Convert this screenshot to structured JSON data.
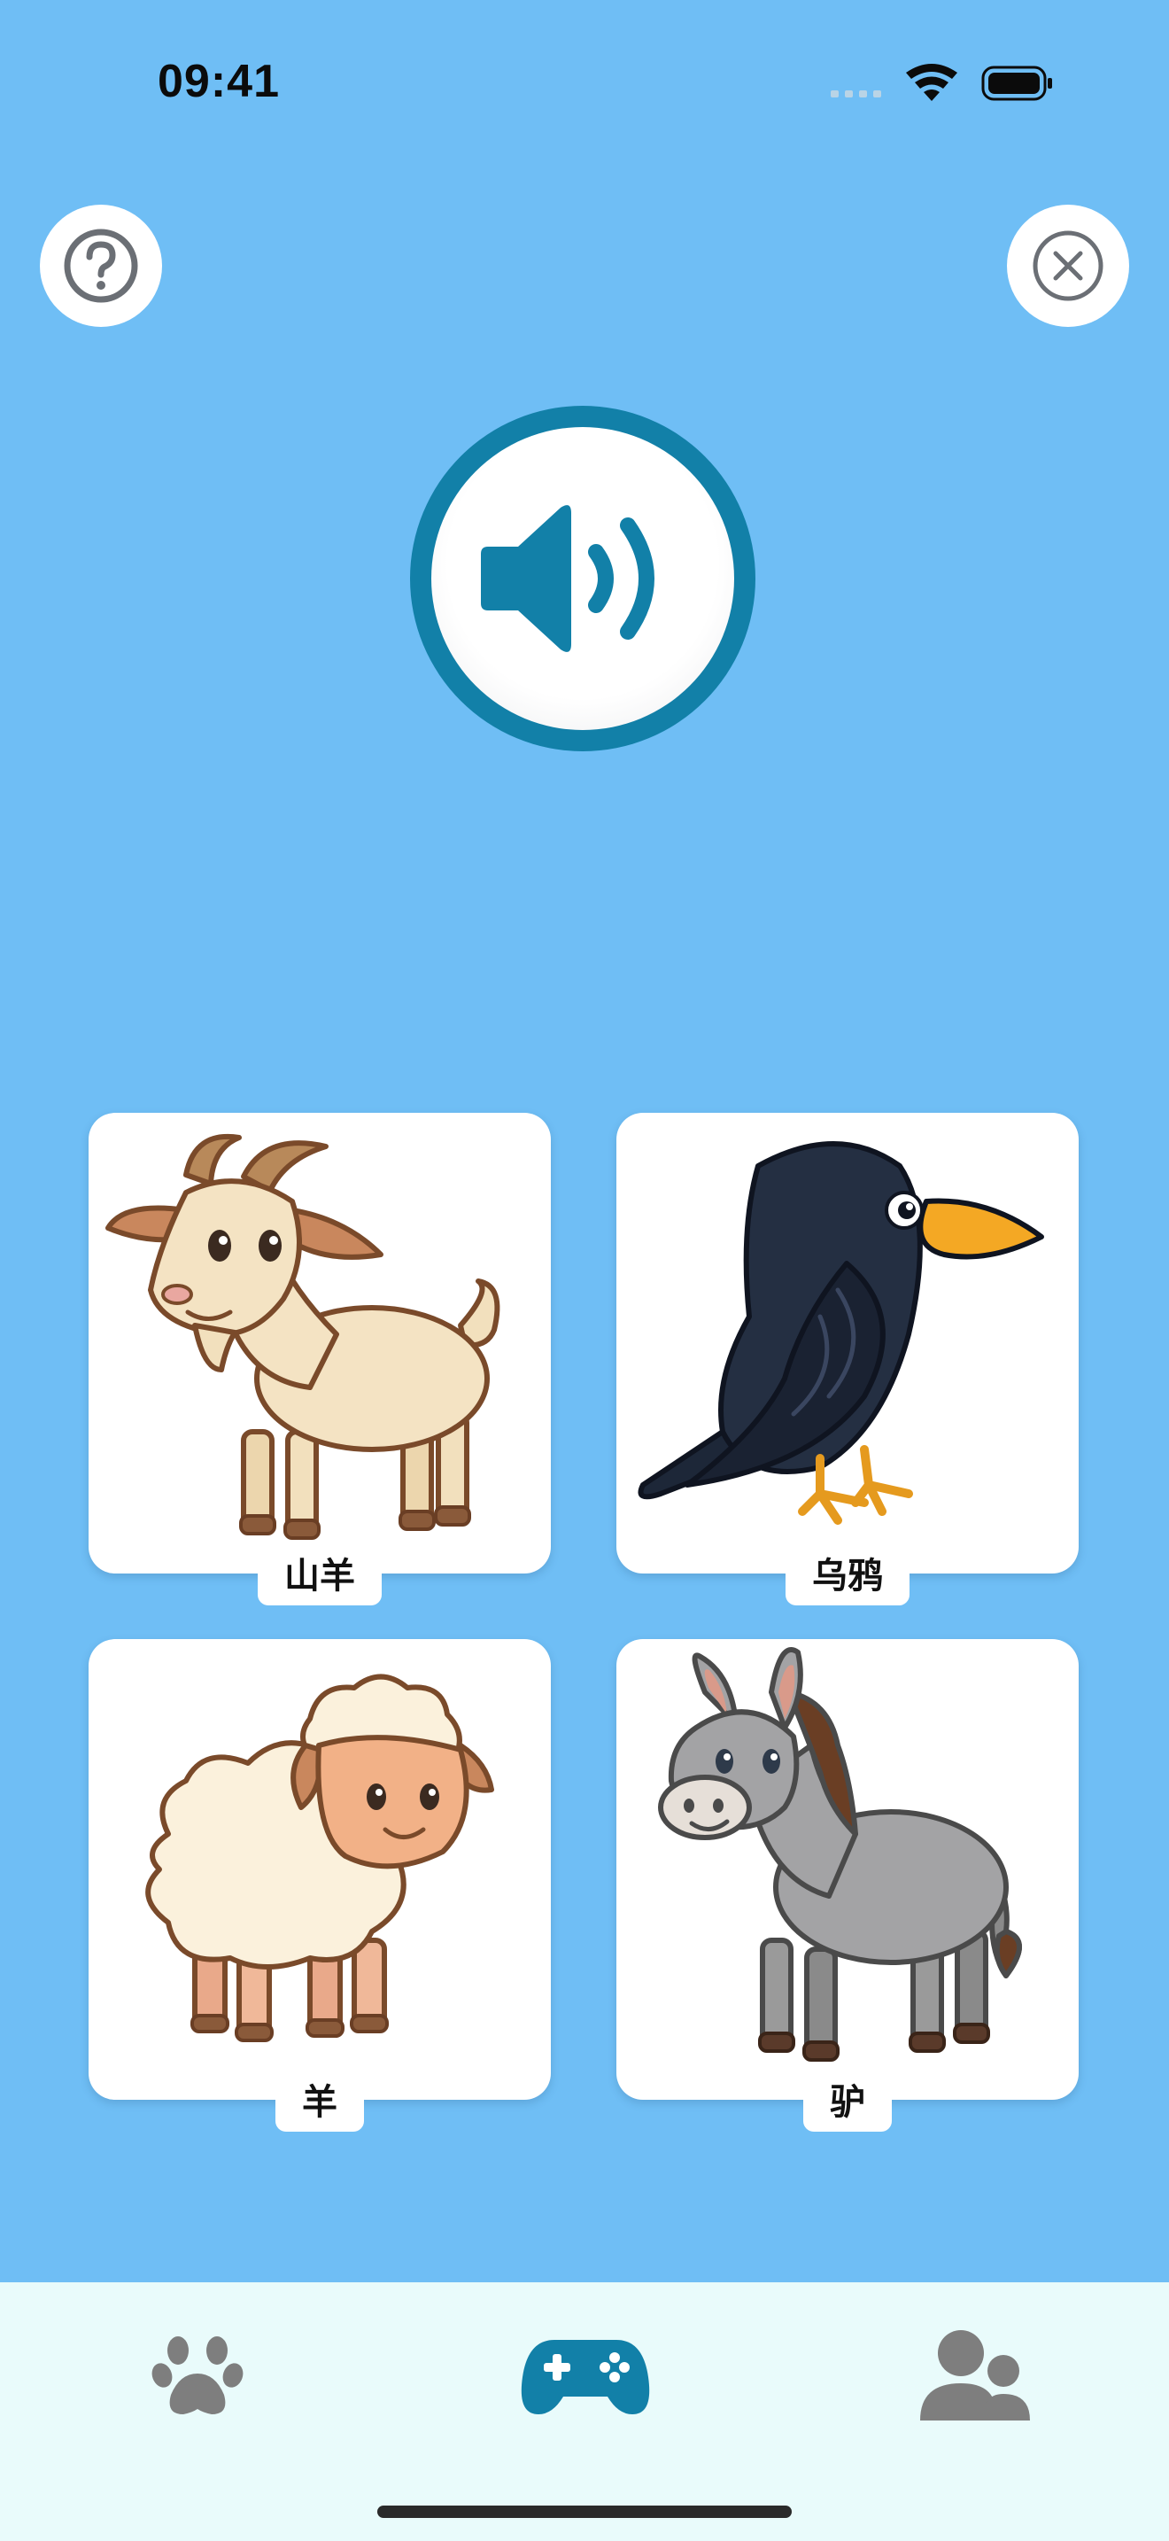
{
  "status_bar": {
    "time": "09:41"
  },
  "header": {
    "help_icon": "question-circle-icon",
    "close_icon": "close-circle-icon"
  },
  "sound_button": {
    "icon": "speaker-volume-icon",
    "accent": "#1280a8"
  },
  "cards": [
    {
      "label": "山羊",
      "icon": "goat-illustration"
    },
    {
      "label": "乌鸦",
      "icon": "crow-illustration"
    },
    {
      "label": "羊",
      "icon": "sheep-illustration"
    },
    {
      "label": "驴",
      "icon": "donkey-illustration"
    }
  ],
  "tabbar": {
    "items": [
      {
        "icon": "paw-icon",
        "active": false
      },
      {
        "icon": "gamepad-icon",
        "active": true
      },
      {
        "icon": "users-icon",
        "active": false
      }
    ],
    "active_color": "#1280a8",
    "inactive_color": "#7e7e7e"
  },
  "colors": {
    "background": "#6fbef5",
    "tabbar": "#e9fbfb"
  }
}
